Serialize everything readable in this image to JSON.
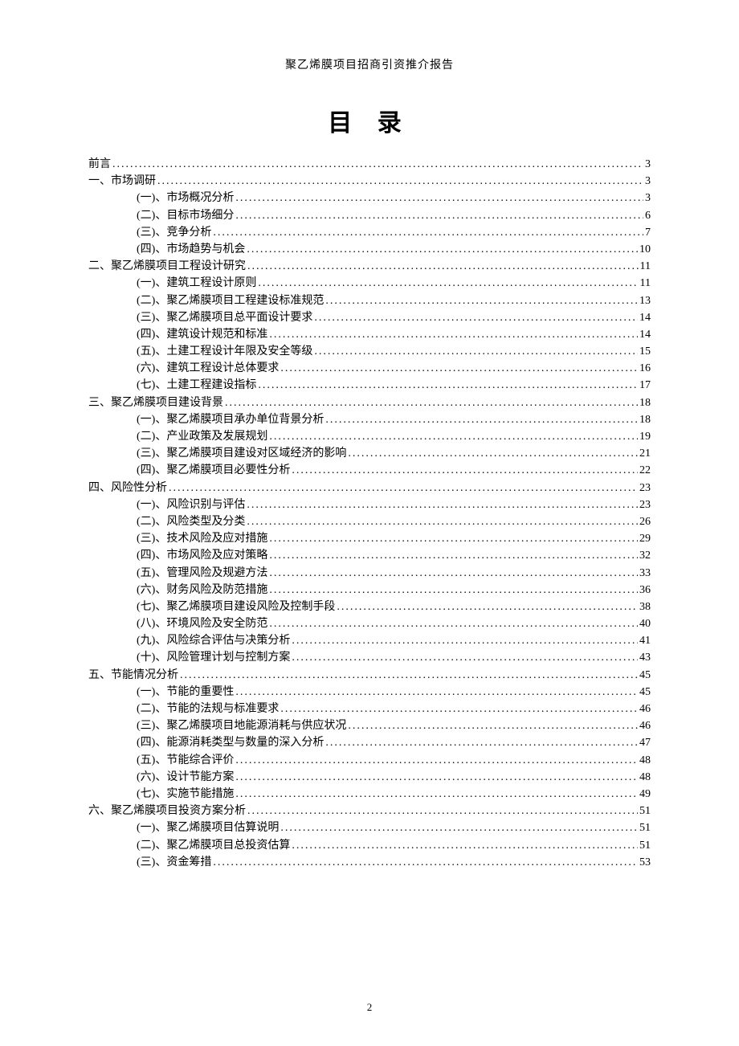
{
  "header": "聚乙烯膜项目招商引资推介报告",
  "toc_title": "目 录",
  "page_number": "2",
  "toc": [
    {
      "level": 0,
      "label": "前言",
      "page": "3"
    },
    {
      "level": 1,
      "label": "一、市场调研",
      "page": "3"
    },
    {
      "level": 2,
      "label": "(一)、市场概况分析",
      "page": "3"
    },
    {
      "level": 2,
      "label": "(二)、目标市场细分",
      "page": "6"
    },
    {
      "level": 2,
      "label": "(三)、竞争分析",
      "page": "7"
    },
    {
      "level": 2,
      "label": "(四)、市场趋势与机会",
      "page": "10"
    },
    {
      "level": 1,
      "label": "二、聚乙烯膜项目工程设计研究",
      "page": "11"
    },
    {
      "level": 2,
      "label": "(一)、建筑工程设计原则",
      "page": "11"
    },
    {
      "level": 2,
      "label": "(二)、聚乙烯膜项目工程建设标准规范",
      "page": "13"
    },
    {
      "level": 2,
      "label": "(三)、聚乙烯膜项目总平面设计要求",
      "page": "14"
    },
    {
      "level": 2,
      "label": "(四)、建筑设计规范和标准",
      "page": "14"
    },
    {
      "level": 2,
      "label": "(五)、土建工程设计年限及安全等级",
      "page": "15"
    },
    {
      "level": 2,
      "label": "(六)、建筑工程设计总体要求",
      "page": "16"
    },
    {
      "level": 2,
      "label": "(七)、土建工程建设指标",
      "page": "17"
    },
    {
      "level": 1,
      "label": "三、聚乙烯膜项目建设背景",
      "page": "18"
    },
    {
      "level": 2,
      "label": "(一)、聚乙烯膜项目承办单位背景分析",
      "page": "18"
    },
    {
      "level": 2,
      "label": "(二)、产业政策及发展规划",
      "page": "19"
    },
    {
      "level": 2,
      "label": "(三)、聚乙烯膜项目建设对区域经济的影响",
      "page": "21"
    },
    {
      "level": 2,
      "label": "(四)、聚乙烯膜项目必要性分析",
      "page": "22"
    },
    {
      "level": 1,
      "label": "四、风险性分析",
      "page": "23"
    },
    {
      "level": 2,
      "label": "(一)、风险识别与评估",
      "page": "23"
    },
    {
      "level": 2,
      "label": "(二)、风险类型及分类",
      "page": "26"
    },
    {
      "level": 2,
      "label": "(三)、技术风险及应对措施",
      "page": "29"
    },
    {
      "level": 2,
      "label": "(四)、市场风险及应对策略",
      "page": "32"
    },
    {
      "level": 2,
      "label": "(五)、管理风险及规避方法",
      "page": "33"
    },
    {
      "level": 2,
      "label": "(六)、财务风险及防范措施",
      "page": "36"
    },
    {
      "level": 2,
      "label": "(七)、聚乙烯膜项目建设风险及控制手段",
      "page": "38"
    },
    {
      "level": 2,
      "label": "(八)、环境风险及安全防范",
      "page": "40"
    },
    {
      "level": 2,
      "label": "(九)、风险综合评估与决策分析",
      "page": "41"
    },
    {
      "level": 2,
      "label": "(十)、风险管理计划与控制方案",
      "page": "43"
    },
    {
      "level": 1,
      "label": "五、节能情况分析",
      "page": "45"
    },
    {
      "level": 2,
      "label": "(一)、节能的重要性",
      "page": "45"
    },
    {
      "level": 2,
      "label": "(二)、节能的法规与标准要求",
      "page": "46"
    },
    {
      "level": 2,
      "label": "(三)、聚乙烯膜项目地能源消耗与供应状况",
      "page": "46"
    },
    {
      "level": 2,
      "label": "(四)、能源消耗类型与数量的深入分析",
      "page": "47"
    },
    {
      "level": 2,
      "label": "(五)、节能综合评价",
      "page": "48"
    },
    {
      "level": 2,
      "label": "(六)、设计节能方案",
      "page": "48"
    },
    {
      "level": 2,
      "label": "(七)、实施节能措施",
      "page": "49"
    },
    {
      "level": 1,
      "label": "六、聚乙烯膜项目投资方案分析",
      "page": "51"
    },
    {
      "level": 2,
      "label": "(一)、聚乙烯膜项目估算说明",
      "page": "51"
    },
    {
      "level": 2,
      "label": "(二)、聚乙烯膜项目总投资估算",
      "page": "51"
    },
    {
      "level": 2,
      "label": "(三)、资金筹措",
      "page": "53"
    }
  ]
}
